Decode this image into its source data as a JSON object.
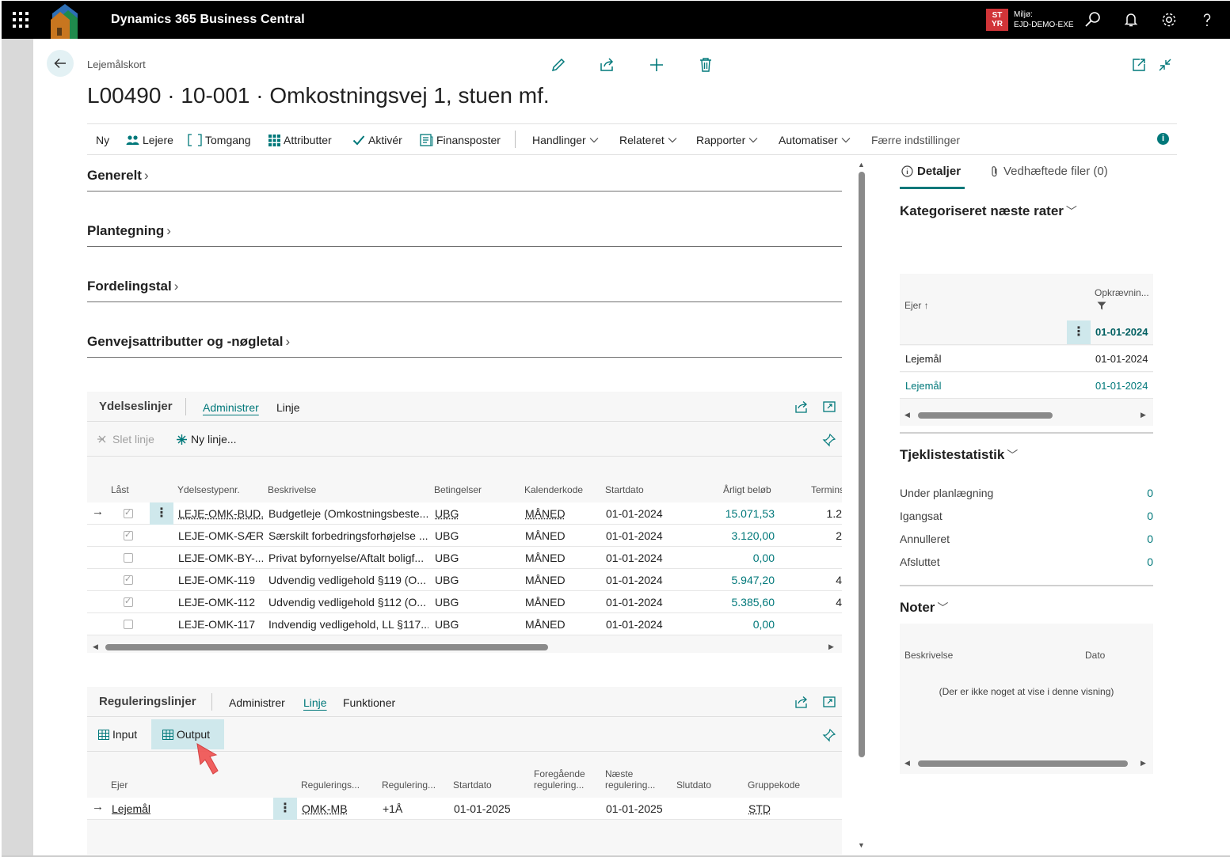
{
  "app": {
    "name": "Dynamics 365 Business Central",
    "env_badge": "ST YR",
    "env_label": "Miljø:",
    "env_name": "EJD-DEMO-EXE"
  },
  "page": {
    "breadcrumb": "Lejemålskort",
    "title": "L00490 · 10-001 · Omkostningsvej 1, stuen mf."
  },
  "actions": {
    "items": [
      "Ny",
      "Lejere",
      "Tomgang",
      "Attributter",
      "Aktivér",
      "Finansposter"
    ],
    "menus": [
      "Handlinger",
      "Relateret",
      "Rapporter",
      "Automatiser"
    ],
    "fewer": "Færre indstillinger",
    "info": "i"
  },
  "fasttabs": [
    "Generelt",
    "Plantegning",
    "Fordelingstal",
    "Genvejsattributter og -nøgletal"
  ],
  "ydelseslinjer": {
    "title": "Ydelseslinjer",
    "tabs": [
      "Administrer",
      "Linje"
    ],
    "delete_line": "Slet linje",
    "new_line": "Ny linje...",
    "columns": [
      "Låst",
      "Ydelsestypenr.",
      "Beskrivelse",
      "Betingelser",
      "Kalenderkode",
      "Startdato",
      "Årligt beløb",
      "Termins"
    ],
    "rows": [
      {
        "locked": true,
        "type": "LEJE-OMK-BUD...",
        "desc": "Budgetleje (Omkostningsbeste...",
        "cond": "UBG",
        "cal": "MÅNED",
        "start": "01-01-2024",
        "amount": "15.071,53",
        "term": "1.2"
      },
      {
        "locked": true,
        "type": "LEJE-OMK-SÆR...",
        "desc": "Særskilt forbedringsforhøjelse ...",
        "cond": "UBG",
        "cal": "MÅNED",
        "start": "01-01-2024",
        "amount": "3.120,00",
        "term": "2"
      },
      {
        "locked": false,
        "type": "LEJE-OMK-BY-...",
        "desc": "Privat byfornyelse/Aftalt boligf...",
        "cond": "UBG",
        "cal": "MÅNED",
        "start": "01-01-2024",
        "amount": "0,00",
        "term": ""
      },
      {
        "locked": true,
        "type": "LEJE-OMK-119",
        "desc": "Udvendig vedligehold §119 (O...",
        "cond": "UBG",
        "cal": "MÅNED",
        "start": "01-01-2024",
        "amount": "5.947,20",
        "term": "4"
      },
      {
        "locked": true,
        "type": "LEJE-OMK-112",
        "desc": "Udvendig vedligehold §112 (O...",
        "cond": "UBG",
        "cal": "MÅNED",
        "start": "01-01-2024",
        "amount": "5.385,60",
        "term": "4"
      },
      {
        "locked": false,
        "type": "LEJE-OMK-117",
        "desc": "Indvendig vedligehold, LL §117...",
        "cond": "UBG",
        "cal": "MÅNED",
        "start": "01-01-2024",
        "amount": "0,00",
        "term": ""
      }
    ]
  },
  "reguleringslinjer": {
    "title": "Reguleringslinjer",
    "tabs": [
      "Administrer",
      "Linje",
      "Funktioner"
    ],
    "input_label": "Input",
    "output_label": "Output",
    "columns": [
      "Ejer",
      "Regulerings...",
      "Regulering...",
      "Startdato",
      "Foregående regulering...",
      "Næste regulering...",
      "Slutdato",
      "Gruppekode"
    ],
    "columns_line1": [
      "Foregående",
      "Næste"
    ],
    "columns_line2": [
      "regulering...",
      "regulering..."
    ],
    "rows": [
      {
        "owner": "Lejemål",
        "code": "OMK-MB",
        "reg": "+1Å",
        "start": "01-01-2025",
        "prev": "",
        "next": "01-01-2025",
        "end": "",
        "group": "STD"
      }
    ]
  },
  "factbox": {
    "tabs": [
      "Detaljer",
      "Vedhæftede filer (0)"
    ],
    "rates": {
      "title": "Kategoriseret næste rater",
      "col_owner": "Ejer",
      "col_date": "Opkrævnin...",
      "rows": [
        {
          "owner": "",
          "date": "01-01-2024"
        },
        {
          "owner": "Lejemål",
          "date": "01-01-2024"
        },
        {
          "owner": "Lejemål",
          "date": "01-01-2024"
        }
      ]
    },
    "checklist": {
      "title": "Tjeklistestatistik",
      "rows": [
        {
          "label": "Under planlægning",
          "value": "0"
        },
        {
          "label": "Igangsat",
          "value": "0"
        },
        {
          "label": "Annulleret",
          "value": "0"
        },
        {
          "label": "Afsluttet",
          "value": "0"
        }
      ]
    },
    "notes": {
      "title": "Noter",
      "col_desc": "Beskrivelse",
      "col_date": "Dato",
      "empty": "(Der er ikke noget at vise i denne visning)"
    }
  },
  "colors": {
    "accent": "#00787a",
    "topbar": "#000000",
    "env_badge": "#d13438"
  }
}
